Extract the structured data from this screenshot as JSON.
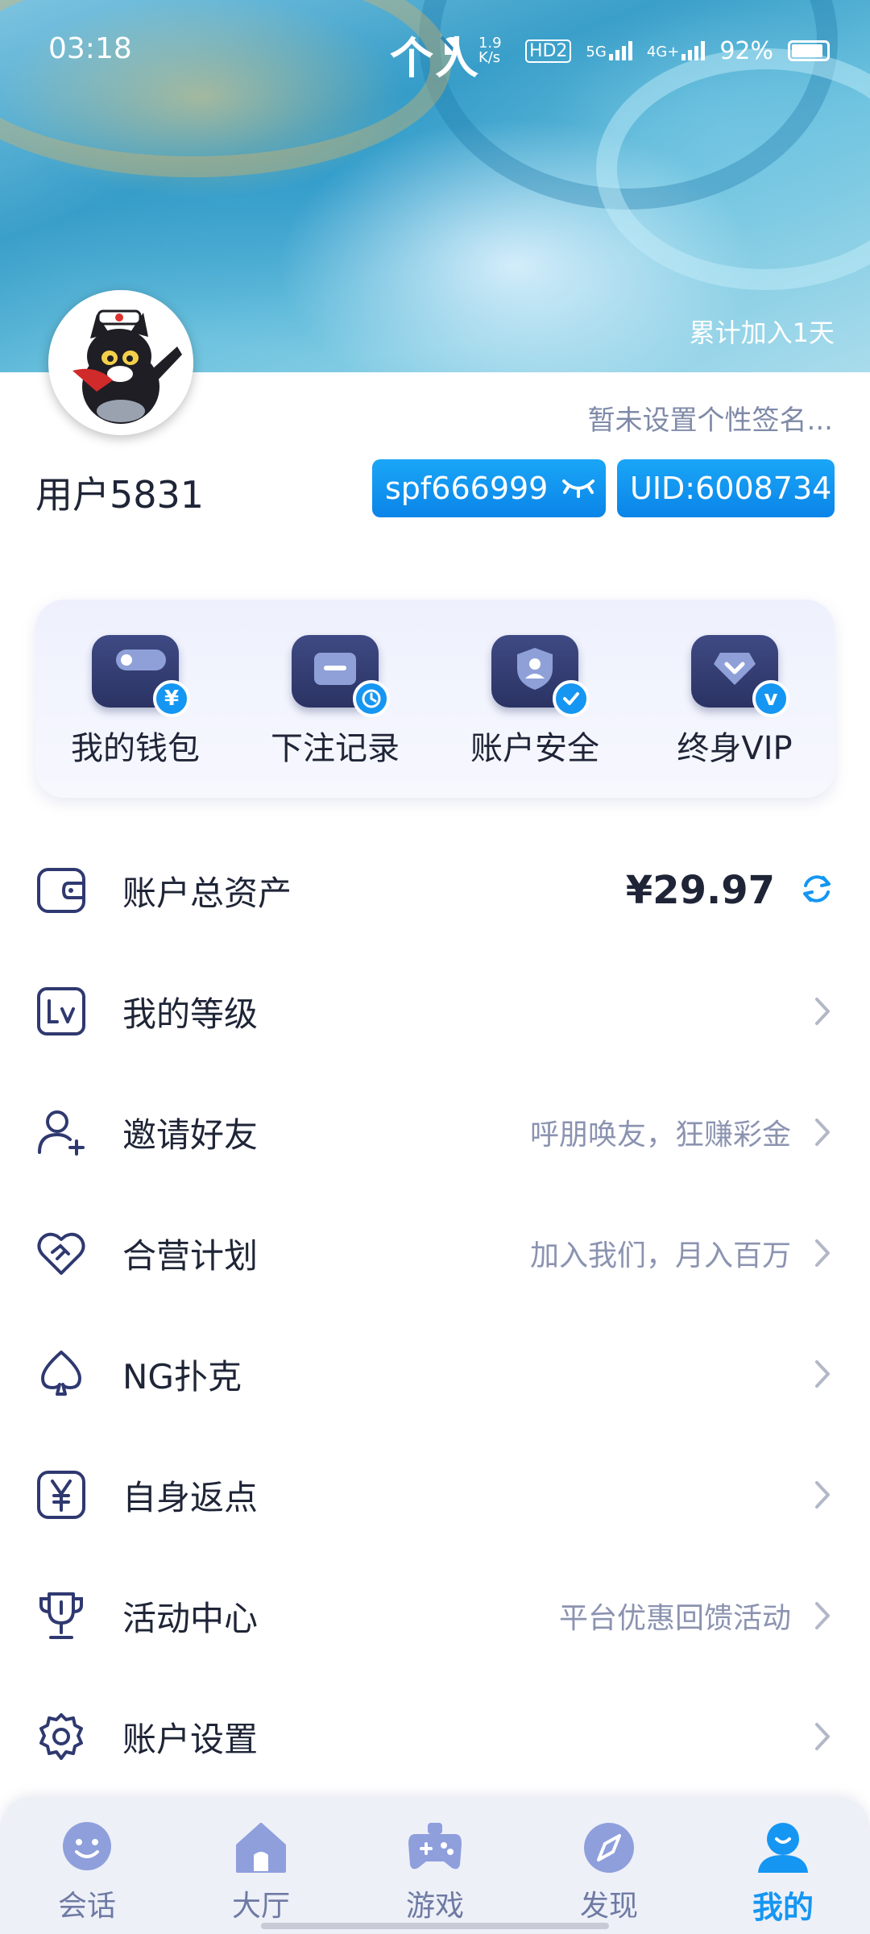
{
  "status_bar": {
    "time": "03:18",
    "network_speed": "1.9 K/s",
    "hd_label": "HD2",
    "network_1": "5G",
    "network_2": "4G+",
    "battery": "92%"
  },
  "header": {
    "title": "个人",
    "join_days": "累计加入1天"
  },
  "profile": {
    "signature": "暂未设置个性签名...",
    "username": "用户5831",
    "account": "spf666999",
    "uid": "UID:6008734"
  },
  "quick_actions": [
    {
      "label": "我的钱包",
      "icon": "wallet-icon",
      "badge": "¥"
    },
    {
      "label": "下注记录",
      "icon": "folder-icon",
      "badge": "clock"
    },
    {
      "label": "账户安全",
      "icon": "shield-icon",
      "badge": "check"
    },
    {
      "label": "终身VIP",
      "icon": "diamond-icon",
      "badge": "v"
    }
  ],
  "menu": {
    "total_assets": {
      "label": "账户总资产",
      "value": "¥29.97"
    },
    "level": {
      "label": "我的等级"
    },
    "invite": {
      "label": "邀请好友",
      "hint": "呼朋唤友，狂赚彩金"
    },
    "partner": {
      "label": "合营计划",
      "hint": "加入我们，月入百万"
    },
    "poker": {
      "label": "NG扑克"
    },
    "rebate": {
      "label": "自身返点"
    },
    "events": {
      "label": "活动中心",
      "hint": "平台优惠回馈活动"
    },
    "settings": {
      "label": "账户设置"
    }
  },
  "bottom_nav": [
    {
      "label": "会话",
      "icon": "chat-icon",
      "active": false
    },
    {
      "label": "大厅",
      "icon": "home-icon",
      "active": false
    },
    {
      "label": "游戏",
      "icon": "gamepad-icon",
      "active": false
    },
    {
      "label": "发现",
      "icon": "compass-icon",
      "active": false
    },
    {
      "label": "我的",
      "icon": "user-icon",
      "active": true
    }
  ],
  "colors": {
    "accent": "#1596f2",
    "text_primary": "#1f2537",
    "text_hint": "#8b93b0",
    "icon_dark": "#2f3970"
  }
}
